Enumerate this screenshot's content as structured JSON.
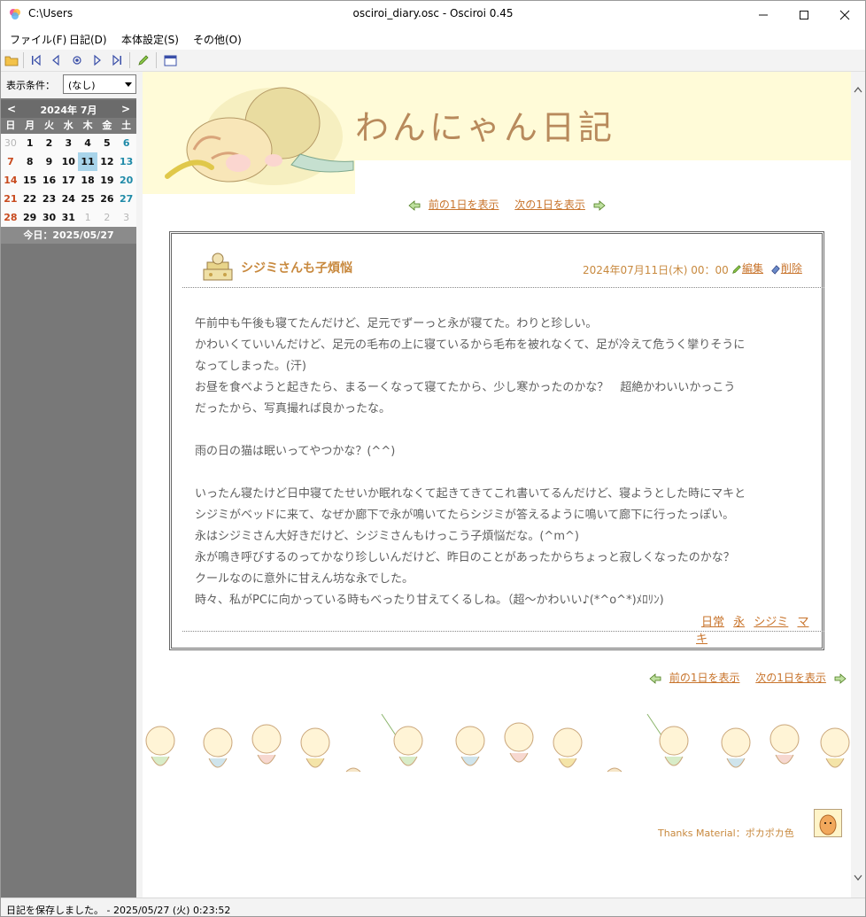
{
  "window": {
    "path": "C:\\Users",
    "title": "osciroi_diary.osc - Osciroi 0.45"
  },
  "menu": [
    "ファイル(F)",
    "日記(D)",
    "本体設定(S)",
    "その他(O)"
  ],
  "sidebar": {
    "filter_label": "表示条件：",
    "filter_value": "(なし)",
    "calendar": {
      "prev": "<",
      "next": ">",
      "month": "2024年 7月",
      "weekdays": [
        "日",
        "月",
        "火",
        "水",
        "木",
        "金",
        "土"
      ],
      "days": [
        [
          "30",
          "1",
          "2",
          "3",
          "4",
          "5",
          "6"
        ],
        [
          "7",
          "8",
          "9",
          "10",
          "11",
          "12",
          "13"
        ],
        [
          "14",
          "15",
          "16",
          "17",
          "18",
          "19",
          "20"
        ],
        [
          "21",
          "22",
          "23",
          "24",
          "25",
          "26",
          "27"
        ],
        [
          "28",
          "29",
          "30",
          "31",
          "1",
          "2",
          "3"
        ]
      ],
      "selected": "11",
      "today": "今日：2025/05/27"
    }
  },
  "diary": {
    "title": "わんにゃん日記",
    "nav": {
      "prev": "前の1日を表示",
      "next": "次の1日を表示"
    },
    "entry": {
      "title": "シジミさんも子煩悩",
      "date": "2024年07月11日(木) 00：00",
      "edit": "編集",
      "delete": "削除",
      "lines": [
        "午前中も午後も寝てたんだけど、足元でずーっと永が寝てた。わりと珍しい。",
        "かわいくていいんだけど、足元の毛布の上に寝ているから毛布を被れなくて、足が冷えて危うく攣りそうに",
        "なってしまった。(汗)",
        "お昼を食べようと起きたら、まるーくなって寝てたから、少し寒かったのかな？　超絶かわいいかっこう",
        "だったから、写真撮れば良かったな。",
        "",
        "雨の日の猫は眠いってやつかな？(^^)",
        "",
        "いったん寝たけど日中寝てたせいか眠れなくて起きてきてこれ書いてるんだけど、寝ようとした時にマキと",
        "シジミがベッドに来て、なぜか廊下で永が鳴いてたらシジミが答えるように鳴いて廊下に行ったっぽい。",
        "永はシジミさん大好きだけど、シジミさんもけっこう子煩悩だな。(^m^)",
        "永が鳴き呼びするのってかなり珍しいんだけど、昨日のことがあったからちょっと寂しくなったのかな？",
        "クールなのに意外に甘えん坊な永でした。",
        "時々、私がPCに向かっている時もべったり甘えてくるしね。（超〜かわいい♪(*^o^*)ﾒﾛﾘﾝ)"
      ],
      "tags": [
        "日常",
        "永",
        "シジミ",
        "マキ"
      ]
    },
    "thanks": "Thanks Material：ポカポカ色"
  },
  "status": "日記を保存しました。 - 2025/05/27 (火) 0:23:52"
}
